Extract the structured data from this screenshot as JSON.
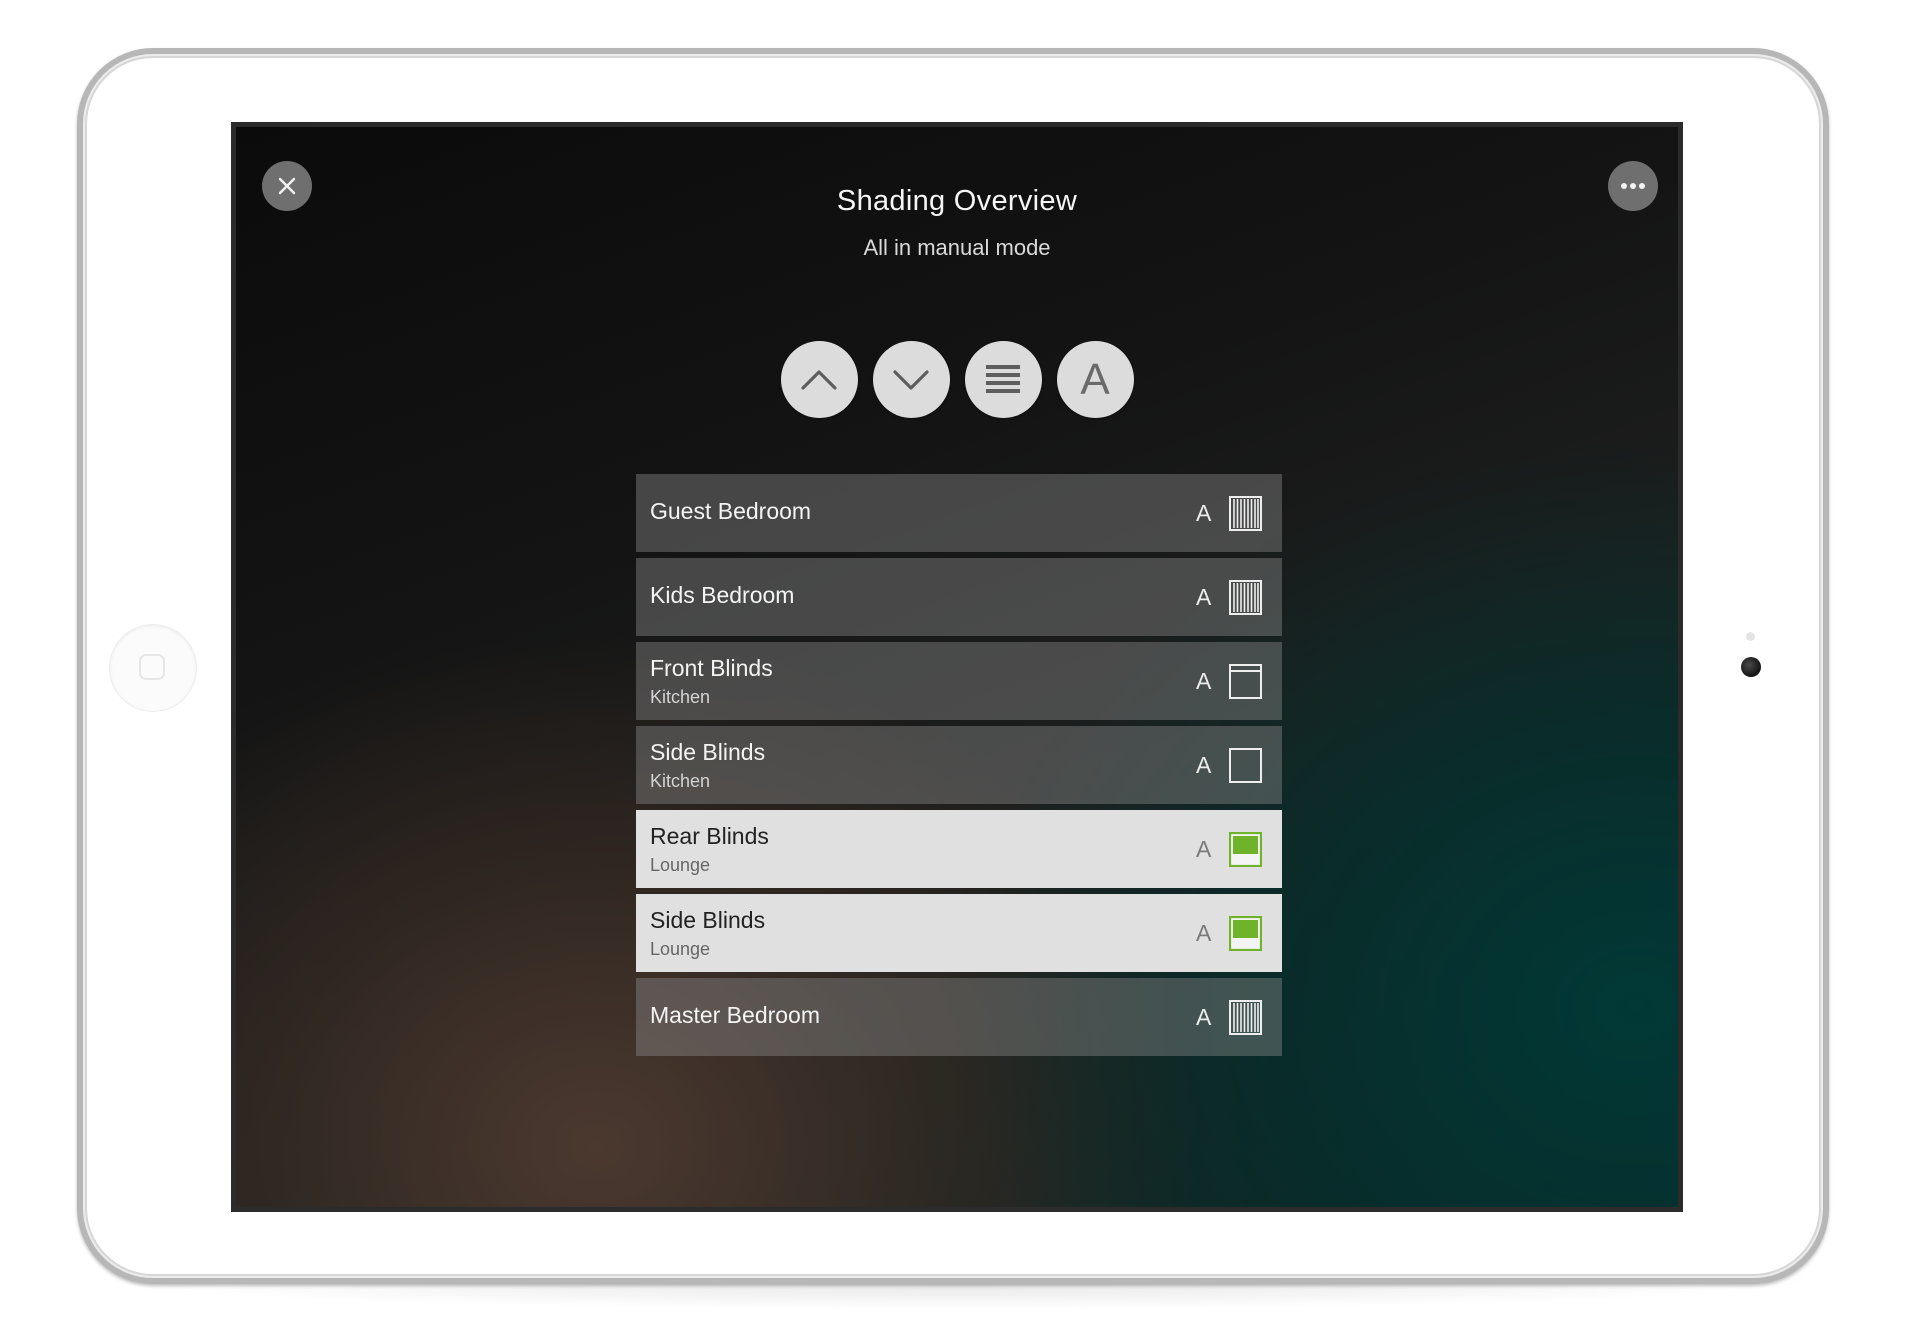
{
  "app": {
    "title": "Shading Overview",
    "subtitle": "All in manual mode"
  },
  "controls": [
    {
      "name": "all-up",
      "icon": "chevron-up-icon"
    },
    {
      "name": "all-down",
      "icon": "chevron-down-icon"
    },
    {
      "name": "all-stop",
      "icon": "lines-icon"
    },
    {
      "name": "all-auto",
      "label": "A",
      "icon": "auto-icon"
    }
  ],
  "rows": [
    {
      "name": "Guest Bedroom",
      "room": "",
      "mode": "A",
      "state": "blinds-closed",
      "active": false
    },
    {
      "name": "Kids Bedroom",
      "room": "",
      "mode": "A",
      "state": "blinds-closed",
      "active": false
    },
    {
      "name": "Front Blinds",
      "room": "Kitchen",
      "mode": "A",
      "state": "shade-partly-closed",
      "active": false
    },
    {
      "name": "Side Blinds",
      "room": "Kitchen",
      "mode": "A",
      "state": "shade-open",
      "active": false
    },
    {
      "name": "Rear Blinds",
      "room": "Lounge",
      "mode": "A",
      "state": "shade-half-green",
      "active": true
    },
    {
      "name": "Side Blinds",
      "room": "Lounge",
      "mode": "A",
      "state": "shade-half-green",
      "active": true
    },
    {
      "name": "Master Bedroom",
      "room": "",
      "mode": "A",
      "state": "blinds-closed",
      "active": false
    }
  ],
  "colors": {
    "accent_green": "#6fb32a",
    "row_active_bg": "#e0e0e0"
  }
}
